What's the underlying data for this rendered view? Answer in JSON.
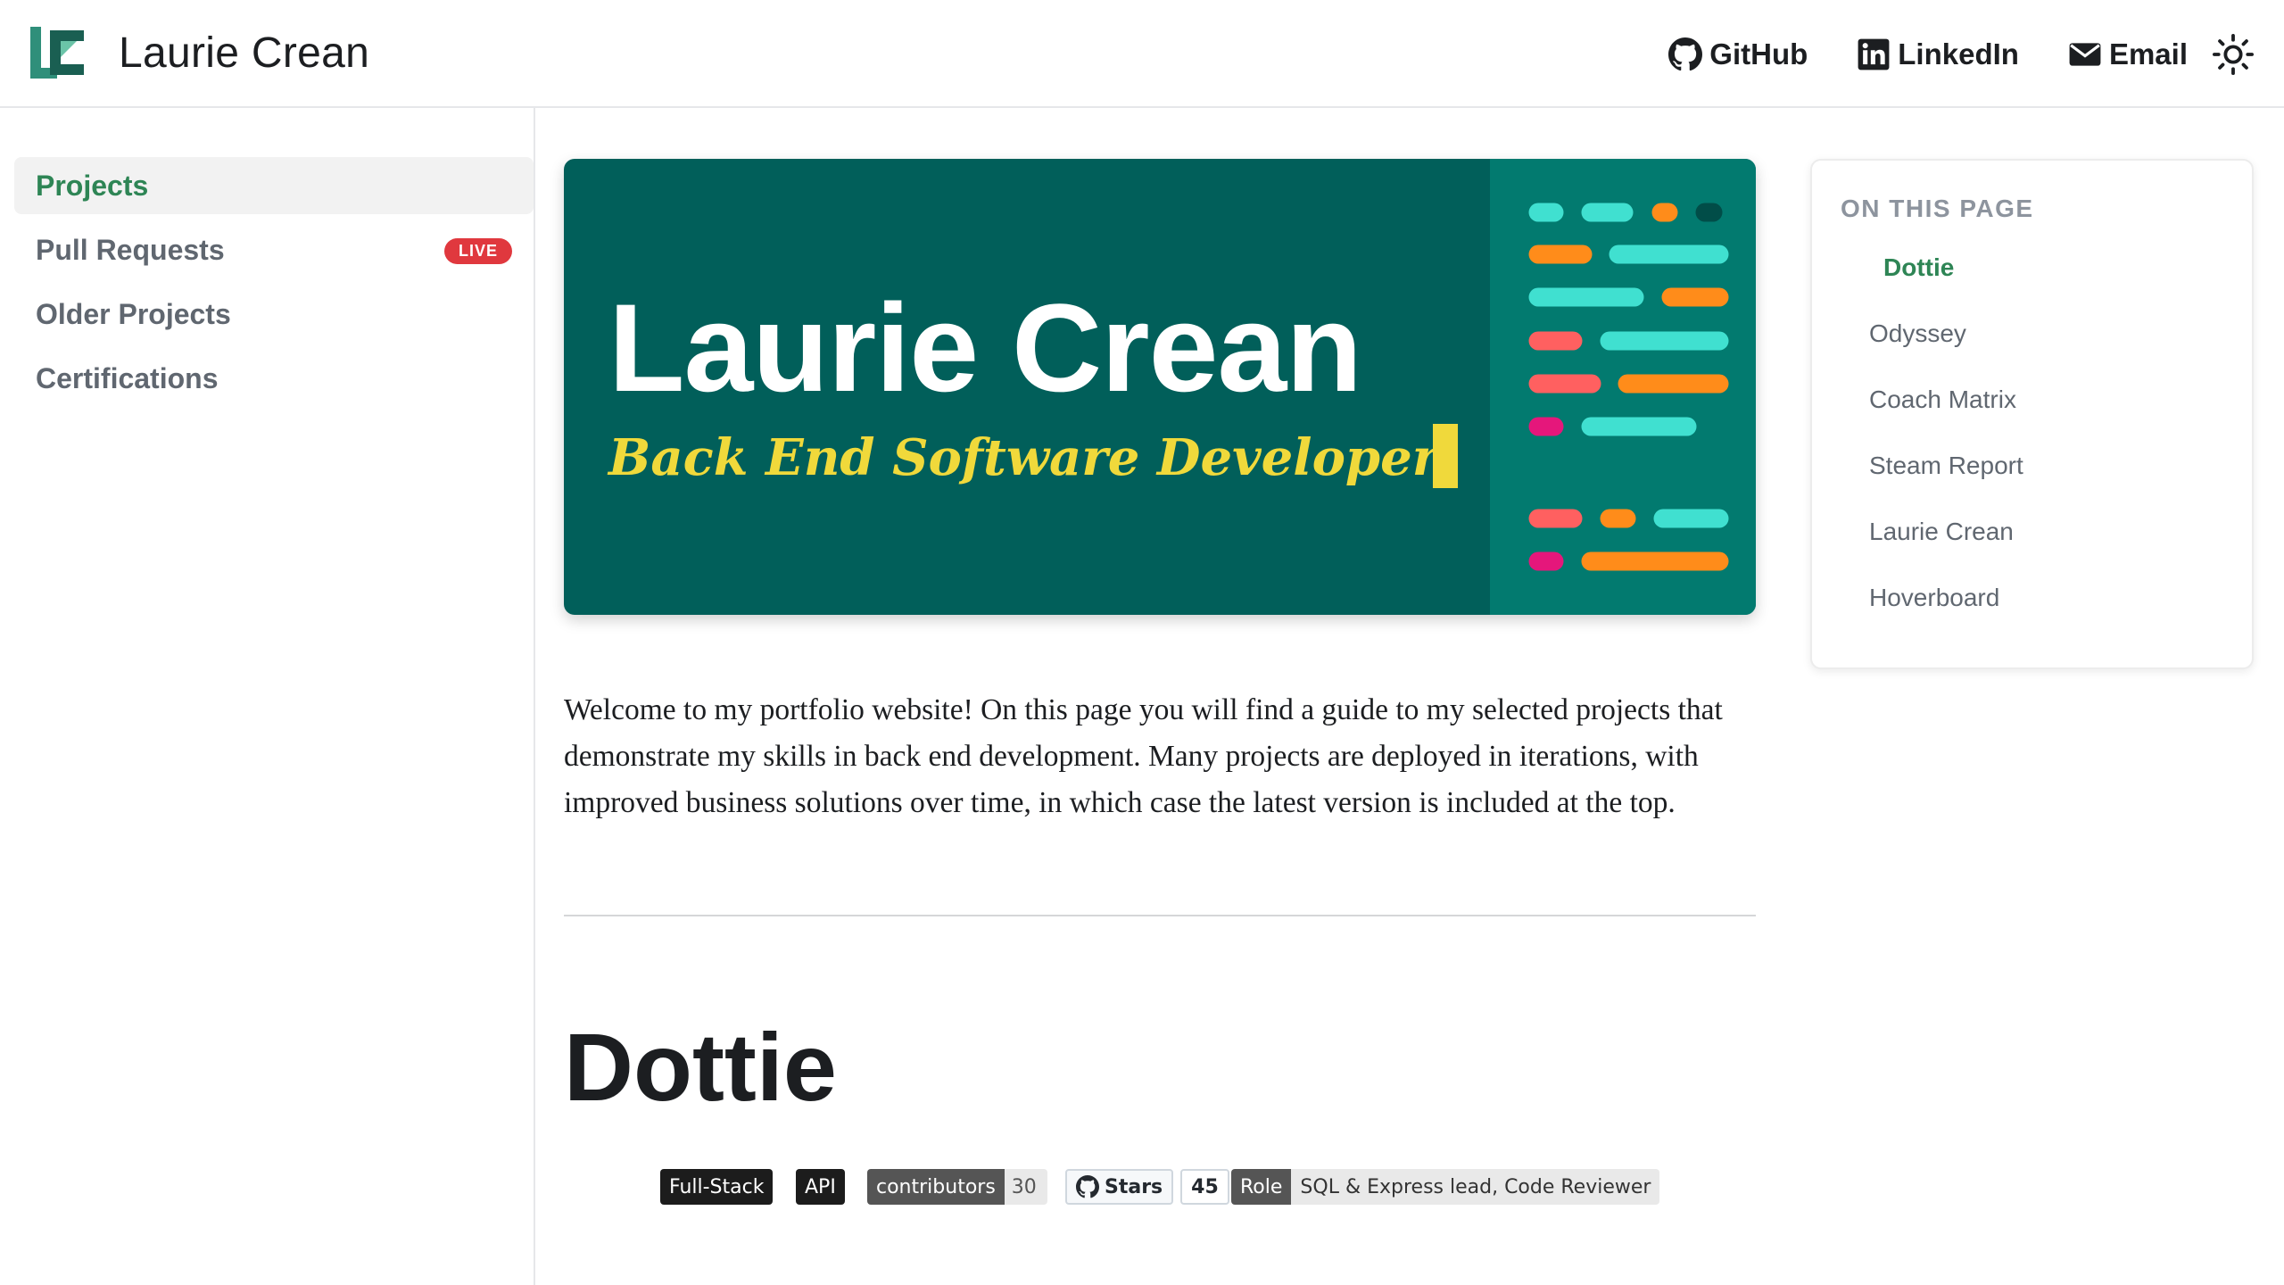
{
  "header": {
    "site_title": "Laurie Crean",
    "links": {
      "github": "GitHub",
      "linkedin": "LinkedIn",
      "email": "Email"
    }
  },
  "sidebar": {
    "items": [
      {
        "label": "Projects",
        "active": true
      },
      {
        "label": "Pull Requests",
        "badge": "LIVE"
      },
      {
        "label": "Older Projects"
      },
      {
        "label": "Certifications"
      }
    ]
  },
  "hero": {
    "name": "Laurie Crean",
    "role": "Back End Software Developer"
  },
  "toc": {
    "heading": "ON THIS PAGE",
    "items": [
      "Dottie",
      "Odyssey",
      "Coach Matrix",
      "Steam Report",
      "Laurie Crean",
      "Hoverboard"
    ],
    "active": "Dottie"
  },
  "intro": "Welcome to my portfolio website! On this page you will find a guide to my selected projects that demonstrate my skills in back end development. Many projects are deployed in iterations, with improved business solutions over time, in which case the latest version is included at the top.",
  "project": {
    "title": "Dottie",
    "badges": {
      "tag1": "Full-Stack",
      "tag2": "API",
      "contributors_label": "contributors",
      "contributors_count": "30",
      "stars_label": "Stars",
      "stars_count": "45",
      "role_label": "Role",
      "role_value": "SQL & Express lead, Code Reviewer"
    }
  },
  "colors": {
    "accent": "#2e8555",
    "hero_bg": "#015f5a",
    "hero_panel": "#027a6f",
    "hero_role": "#f0d93b",
    "live_badge": "#e0383e"
  }
}
